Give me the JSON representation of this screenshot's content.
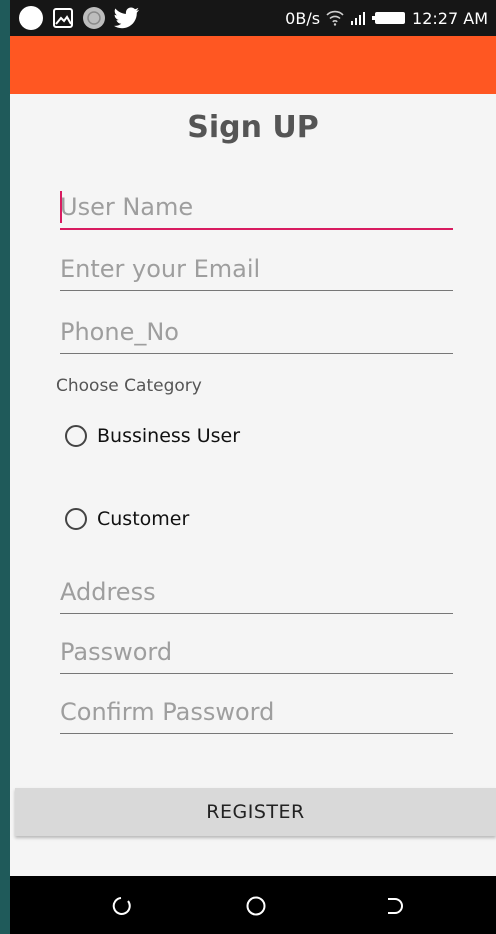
{
  "status_bar": {
    "network_speed": "0B/s",
    "time": "12:27 AM",
    "icons": [
      "circle-icon",
      "image-icon",
      "globe-icon",
      "twitter-icon",
      "wifi-icon",
      "signal-icon",
      "battery-icon"
    ]
  },
  "form": {
    "title": "Sign UP",
    "fields": {
      "username_placeholder": "User Name",
      "email_placeholder": "Enter your Email",
      "phone_placeholder": "Phone_No",
      "address_placeholder": "Address",
      "password_placeholder": "Password",
      "confirm_password_placeholder": "Confirm Password"
    },
    "category_label": "Choose Category",
    "categories": [
      "Bussiness User",
      "Customer"
    ],
    "register_label": "REGISTER"
  },
  "colors": {
    "app_bar": "#ff5722",
    "accent": "#d81b60",
    "background": "#f5f5f5"
  },
  "nav_bar": {
    "icons": [
      "back-icon",
      "home-icon",
      "recents-icon"
    ]
  }
}
